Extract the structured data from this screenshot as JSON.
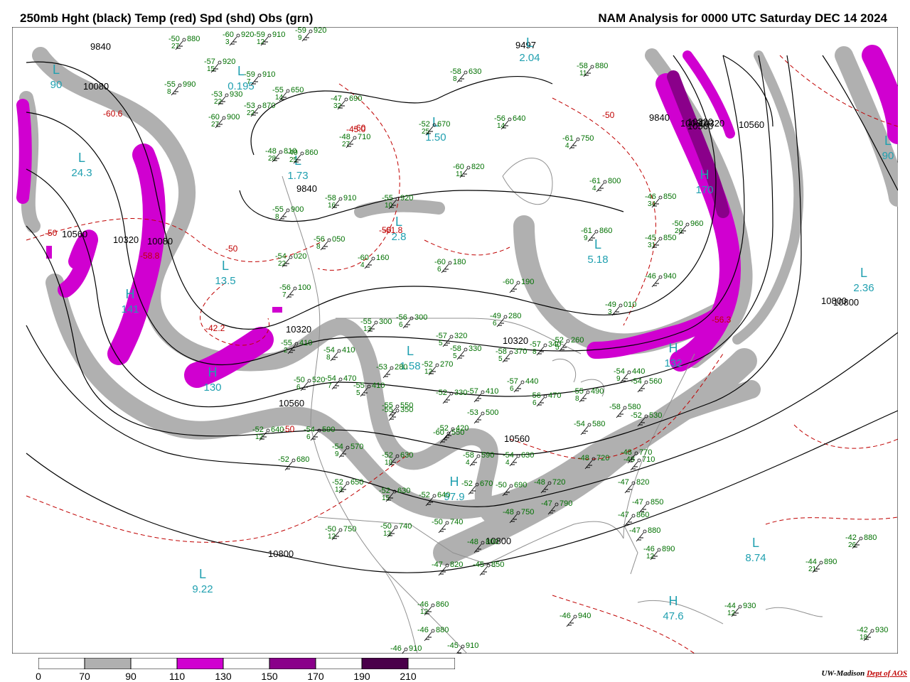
{
  "header": {
    "title_left": "250mb Hght (black) Temp (red) Spd (shd) Obs (grn)",
    "title_right": "NAM Analysis for 0000 UTC Saturday  DEC 14 2024"
  },
  "colors": {
    "height_contour": "#000000",
    "temp_contour": "#c00000",
    "speed_70_90": "#b0b0b0",
    "speed_110_130": "#d000d0",
    "speed_150_170": "#8a008a",
    "speed_190_210": "#4a004a",
    "obs_text": "#007000",
    "hl_labels": "#20a0b0",
    "borders": "#909090"
  },
  "colorbar": {
    "labels": [
      "0",
      "70",
      "90",
      "110",
      "130",
      "150",
      "170",
      "190",
      "210"
    ]
  },
  "height_labels": [
    "9840",
    "10080",
    "9840",
    "10560",
    "10320",
    "10080",
    "10320",
    "10560",
    "10800",
    "10320",
    "10560",
    "10800",
    "9497",
    "9840",
    "10080",
    "10320",
    "10560",
    "10800",
    "10320",
    "10560",
    "10800"
  ],
  "temp_labels": [
    "-60.6",
    "-60",
    "-45.0",
    "-50",
    "-61.8",
    "-58.8",
    "-42.2",
    "-56.3",
    "-50",
    "-50",
    "-50",
    "-50"
  ],
  "hl_markers": [
    {
      "letter": "L",
      "value": "24.3"
    },
    {
      "letter": "H",
      "value": "141"
    },
    {
      "letter": "L",
      "value": "13.5"
    },
    {
      "letter": "H",
      "value": "130"
    },
    {
      "letter": "L",
      "value": "1.73"
    },
    {
      "letter": "L",
      "value": "0.195"
    },
    {
      "letter": "L",
      "value": "2.04"
    },
    {
      "letter": "L",
      "value": "1.50"
    },
    {
      "letter": "L",
      "value": "2.8"
    },
    {
      "letter": "L",
      "value": "1.58"
    },
    {
      "letter": "H",
      "value": "97.9"
    },
    {
      "letter": "L",
      "value": "5.18"
    },
    {
      "letter": "H",
      "value": "170"
    },
    {
      "letter": "H",
      "value": "132"
    },
    {
      "letter": "L",
      "value": "2.36"
    },
    {
      "letter": "L",
      "value": "8.74"
    },
    {
      "letter": "H",
      "value": "47.6"
    },
    {
      "letter": "L",
      "value": "9.22"
    },
    {
      "letter": "L",
      "value": "90"
    },
    {
      "letter": "L",
      "value": "90"
    }
  ],
  "station_obs": [
    {
      "t": "-50",
      "d": "27",
      "h": "880"
    },
    {
      "t": "-60",
      "d": "3",
      "h": "920"
    },
    {
      "t": "-59",
      "d": "12",
      "h": "910"
    },
    {
      "t": "-59",
      "d": "9",
      "h": "920"
    },
    {
      "t": "-57",
      "d": "15",
      "h": "920"
    },
    {
      "t": "-59",
      "d": "7",
      "h": "910"
    },
    {
      "t": "-55",
      "d": "8",
      "h": "990"
    },
    {
      "t": "-53",
      "d": "22",
      "h": "930"
    },
    {
      "t": "-55",
      "d": "14",
      "h": "650"
    },
    {
      "t": "-53",
      "d": "22",
      "h": "870"
    },
    {
      "t": "-60",
      "d": "27",
      "h": "900"
    },
    {
      "t": "-47",
      "d": "32",
      "h": "690"
    },
    {
      "t": "-48",
      "d": "27",
      "h": "710"
    },
    {
      "t": "-58",
      "d": "8",
      "h": "630"
    },
    {
      "t": "-58",
      "d": "11",
      "h": "880"
    },
    {
      "t": "-52",
      "d": "25",
      "h": "670"
    },
    {
      "t": "-56",
      "d": "14",
      "h": "640"
    },
    {
      "t": "-61",
      "d": "4",
      "h": "750"
    },
    {
      "t": "-48",
      "d": "28",
      "h": "810"
    },
    {
      "t": "-49",
      "d": "25",
      "h": "860"
    },
    {
      "t": "-60",
      "d": "11",
      "h": "820"
    },
    {
      "t": "-61",
      "d": "4",
      "h": "800"
    },
    {
      "t": "-58",
      "d": "16",
      "h": "910"
    },
    {
      "t": "-55",
      "d": "10",
      "h": "920"
    },
    {
      "t": "-55",
      "d": "8",
      "h": "900"
    },
    {
      "t": "-46",
      "d": "34",
      "h": "850"
    },
    {
      "t": "-50",
      "d": "26",
      "h": "960"
    },
    {
      "t": "-56",
      "d": "8",
      "h": "050"
    },
    {
      "t": "-61",
      "d": "9",
      "h": "860"
    },
    {
      "t": "-45",
      "d": "31",
      "h": "850"
    },
    {
      "t": "-54",
      "d": "22",
      "h": "020"
    },
    {
      "t": "-60",
      "d": "4",
      "h": "160"
    },
    {
      "t": "-60",
      "d": "6",
      "h": "180"
    },
    {
      "t": "-46",
      "d": "",
      "h": "940"
    },
    {
      "t": "-56",
      "d": "7",
      "h": "100"
    },
    {
      "t": "-60",
      "d": "",
      "h": "190"
    },
    {
      "t": "-49",
      "d": "3",
      "h": "010"
    },
    {
      "t": "-55",
      "d": "13",
      "h": "300"
    },
    {
      "t": "-56",
      "d": "6",
      "h": "300"
    },
    {
      "t": "-49",
      "d": "6",
      "h": "280"
    },
    {
      "t": "-57",
      "d": "5",
      "h": "320"
    },
    {
      "t": "-55",
      "d": "2",
      "h": "410"
    },
    {
      "t": "-54",
      "d": "8",
      "h": "410"
    },
    {
      "t": "-58",
      "d": "5",
      "h": "330"
    },
    {
      "t": "-58",
      "d": "5",
      "h": "370"
    },
    {
      "t": "-57",
      "d": "8",
      "h": "340"
    },
    {
      "t": "-52",
      "d": "5",
      "h": "260"
    },
    {
      "t": "-52",
      "d": "12",
      "h": "270"
    },
    {
      "t": "-53",
      "d": "",
      "h": "280"
    },
    {
      "t": "-50",
      "d": "6",
      "h": "520"
    },
    {
      "t": "-54",
      "d": "7",
      "h": "470"
    },
    {
      "t": "-55",
      "d": "5",
      "h": "410"
    },
    {
      "t": "-55",
      "d": "",
      "h": "550"
    },
    {
      "t": "-52",
      "d": "",
      "h": "330"
    },
    {
      "t": "-57",
      "d": "",
      "h": "410"
    },
    {
      "t": "-57",
      "d": "6",
      "h": "440"
    },
    {
      "t": "-56",
      "d": "6",
      "h": "470"
    },
    {
      "t": "-55",
      "d": "8",
      "h": "490"
    },
    {
      "t": "-54",
      "d": "9",
      "h": "440"
    },
    {
      "t": "-54",
      "d": "",
      "h": "560"
    },
    {
      "t": "-58",
      "d": "",
      "h": "580"
    },
    {
      "t": "-52",
      "d": "12",
      "h": "640"
    },
    {
      "t": "-54",
      "d": "6",
      "h": "590"
    },
    {
      "t": "-55",
      "d": "",
      "h": "350"
    },
    {
      "t": "-53",
      "d": "",
      "h": "500"
    },
    {
      "t": "-60",
      "d": "",
      "h": "550"
    },
    {
      "t": "-54",
      "d": "9",
      "h": "570"
    },
    {
      "t": "-52",
      "d": "18",
      "h": "630"
    },
    {
      "t": "-52",
      "d": "",
      "h": "420"
    },
    {
      "t": "-58",
      "d": "4",
      "h": "590"
    },
    {
      "t": "-54",
      "d": "4",
      "h": "630"
    },
    {
      "t": "-54",
      "d": "",
      "h": "580"
    },
    {
      "t": "-52",
      "d": "",
      "h": "530"
    },
    {
      "t": "-48",
      "d": "",
      "h": "720"
    },
    {
      "t": "-48",
      "d": "",
      "h": "710"
    },
    {
      "t": "-48",
      "d": "",
      "h": "770"
    },
    {
      "t": "-52",
      "d": "",
      "h": "680"
    },
    {
      "t": "-52",
      "d": "13",
      "h": "650"
    },
    {
      "t": "-52",
      "d": "15",
      "h": "630"
    },
    {
      "t": "-52",
      "d": "",
      "h": "640"
    },
    {
      "t": "-52",
      "d": "",
      "h": "670"
    },
    {
      "t": "-50",
      "d": "",
      "h": "690"
    },
    {
      "t": "-48",
      "d": "",
      "h": "720"
    },
    {
      "t": "-47",
      "d": "",
      "h": "820"
    },
    {
      "t": "-48",
      "d": "",
      "h": "750"
    },
    {
      "t": "-47",
      "d": "",
      "h": "790"
    },
    {
      "t": "-47",
      "d": "",
      "h": "850"
    },
    {
      "t": "-47",
      "d": "",
      "h": "860"
    },
    {
      "t": "-47",
      "d": "",
      "h": "880"
    },
    {
      "t": "-50",
      "d": "12",
      "h": "750"
    },
    {
      "t": "-50",
      "d": "13",
      "h": "740"
    },
    {
      "t": "-50",
      "d": "",
      "h": "740"
    },
    {
      "t": "-48",
      "d": "",
      "h": "800"
    },
    {
      "t": "-47",
      "d": "",
      "h": "820"
    },
    {
      "t": "-45",
      "d": "",
      "h": "850"
    },
    {
      "t": "-46",
      "d": "12",
      "h": "890"
    },
    {
      "t": "-46",
      "d": "12",
      "h": "860"
    },
    {
      "t": "-46",
      "d": "",
      "h": "880"
    },
    {
      "t": "-46",
      "d": "",
      "h": "940"
    },
    {
      "t": "-46",
      "d": "",
      "h": "910"
    },
    {
      "t": "-45",
      "d": "",
      "h": "910"
    },
    {
      "t": "-44",
      "d": "12",
      "h": "930"
    },
    {
      "t": "-44",
      "d": "21",
      "h": "890"
    },
    {
      "t": "-42",
      "d": "26",
      "h": "880"
    },
    {
      "t": "-42",
      "d": "18",
      "h": "930"
    }
  ],
  "credit": {
    "org": "UW-Madison",
    "dept": "Dept of AOS"
  }
}
